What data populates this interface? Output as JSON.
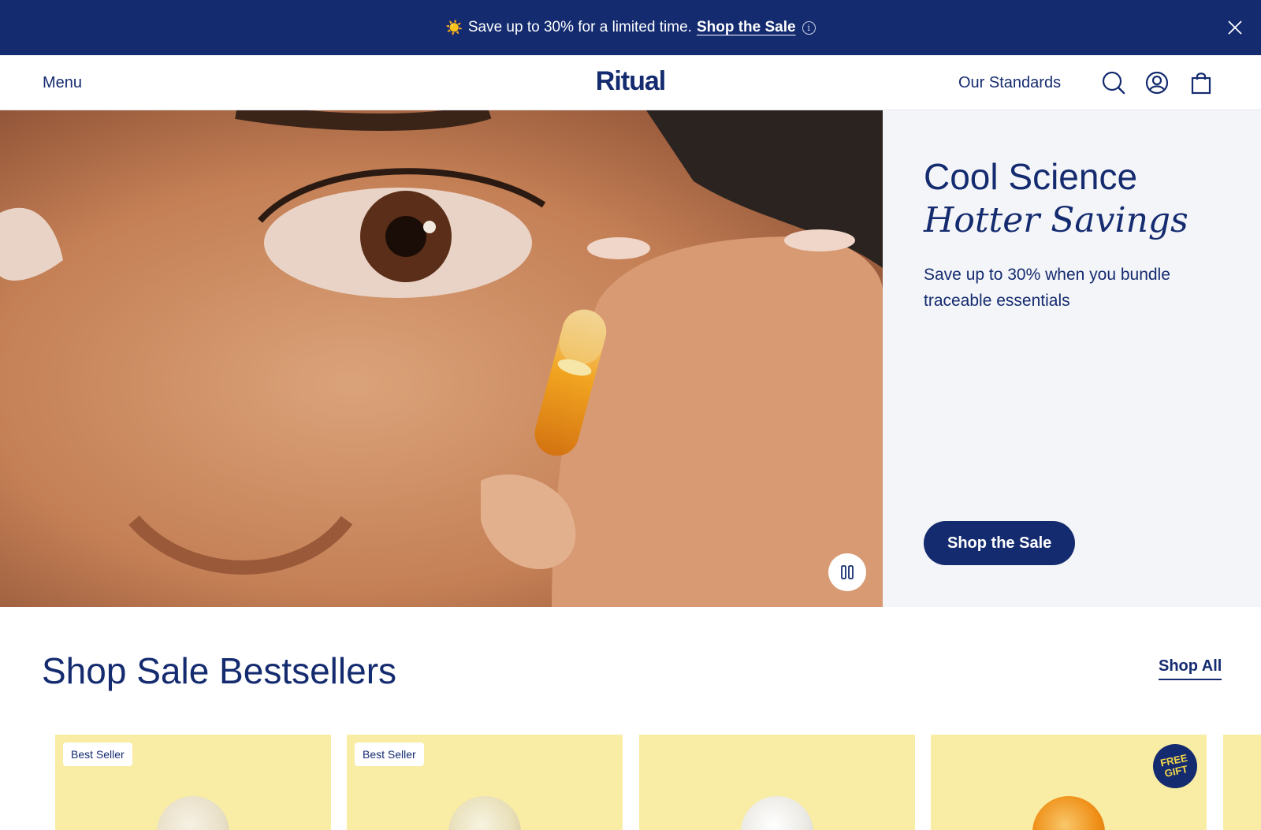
{
  "promo": {
    "icon": "sun-icon",
    "text": "Save up to 30% for a limited time.",
    "link": "Shop the Sale",
    "info_icon": "info-icon",
    "close_icon": "close-icon"
  },
  "header": {
    "menu_label": "Menu",
    "logo": "Ritual",
    "standards_label": "Our Standards",
    "icons": [
      "search-icon",
      "account-icon",
      "bag-icon"
    ]
  },
  "hero": {
    "title_line1": "Cool Science",
    "title_line2": "Hotter Savings",
    "subtitle": "Save up to 30% when you bundle traceable essentials",
    "cta": "Shop the Sale",
    "pause_icon": "pause-icon"
  },
  "bestsellers": {
    "title": "Shop Sale Bestsellers",
    "shop_all": "Shop All",
    "cards": [
      {
        "badge": "Best Seller",
        "gift": ""
      },
      {
        "badge": "Best Seller",
        "gift": ""
      },
      {
        "badge": "",
        "gift": ""
      },
      {
        "badge": "",
        "gift": "FREE GIFT"
      }
    ]
  },
  "colors": {
    "brand_navy": "#142b6f",
    "panel_gray": "#f4f5f8",
    "card_yellow": "#f9eca4"
  }
}
